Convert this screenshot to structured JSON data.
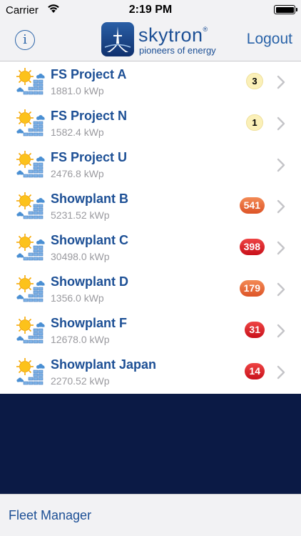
{
  "status_bar": {
    "carrier": "Carrier",
    "time": "2:19 PM"
  },
  "nav": {
    "info_label": "i",
    "logo_name": "skytron",
    "logo_mark": "®",
    "logo_tagline": "pioneers of energy",
    "logout_label": "Logout"
  },
  "plants": [
    {
      "name": "FS Project A",
      "power": "1881.0 kWp",
      "alert_count": "3",
      "alert_level": "warn"
    },
    {
      "name": "FS Project N",
      "power": "1582.4 kWp",
      "alert_count": "1",
      "alert_level": "warn"
    },
    {
      "name": "FS Project U",
      "power": "2476.8 kWp",
      "alert_count": "",
      "alert_level": "none"
    },
    {
      "name": "Showplant B",
      "power": "5231.52 kWp",
      "alert_count": "541",
      "alert_level": "orange"
    },
    {
      "name": "Showplant C",
      "power": "30498.0 kWp",
      "alert_count": "398",
      "alert_level": "red"
    },
    {
      "name": "Showplant D",
      "power": "1356.0 kWp",
      "alert_count": "179",
      "alert_level": "orange"
    },
    {
      "name": "Showplant F",
      "power": "12678.0 kWp",
      "alert_count": "31",
      "alert_level": "red"
    },
    {
      "name": "Showplant Japan",
      "power": "2270.52 kWp",
      "alert_count": "14",
      "alert_level": "red"
    }
  ],
  "footer": {
    "label": "Fleet Manager"
  },
  "colors": {
    "brand": "#1c4f95",
    "link": "#2a63a8",
    "background": "#0b1a45"
  },
  "icons": {
    "weather": "sun-cloud-solar-panels-icon",
    "chevron": "chevron-right-icon",
    "info": "info-icon",
    "wifi": "wifi-icon",
    "battery": "battery-icon"
  }
}
